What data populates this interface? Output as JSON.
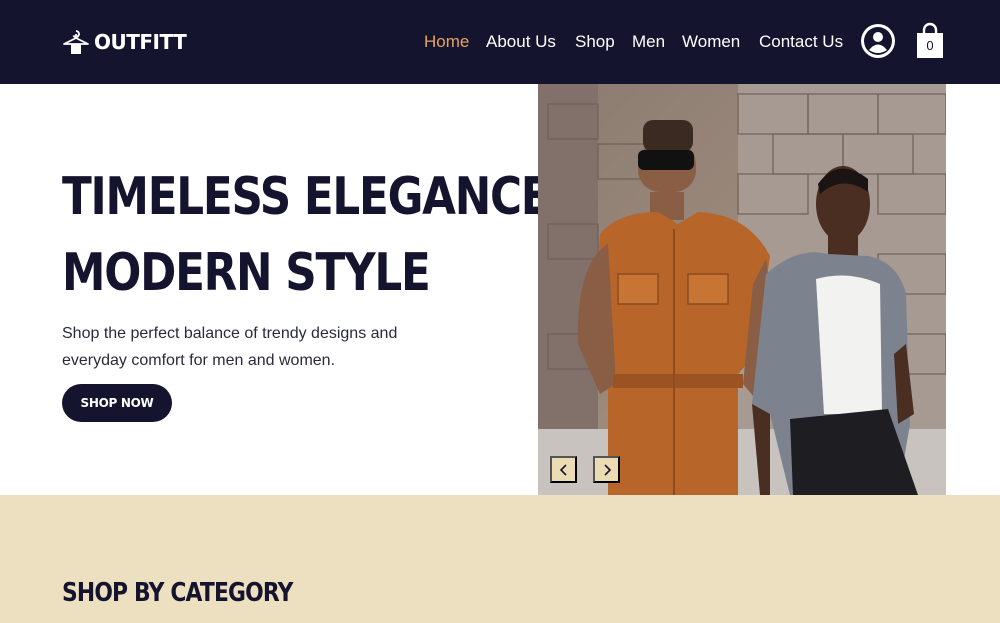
{
  "brand": {
    "name": "OUTFITT",
    "logo_icon": "hanger-icon"
  },
  "nav": {
    "items": [
      {
        "label": "Home",
        "active": true
      },
      {
        "label": "About Us",
        "active": false
      },
      {
        "label": "Shop",
        "active": false
      },
      {
        "label": "Men",
        "active": false
      },
      {
        "label": "Women",
        "active": false
      },
      {
        "label": "Contact Us",
        "active": false
      }
    ],
    "account_icon": "user-avatar-icon",
    "cart_icon": "shopping-bag-icon",
    "cart_count": "0"
  },
  "hero": {
    "title_line1": "TIMELESS ELEGANCE,",
    "title_line2": "MODERN STYLE",
    "subtitle": "Shop the perfect balance of trendy designs and everyday comfort for men and women.",
    "cta_label": "SHOP NOW",
    "prev_icon": "chevron-left-icon",
    "next_icon": "chevron-right-icon"
  },
  "category": {
    "title": "SHOP BY CATEGORY"
  },
  "colors": {
    "navy": "#15142e",
    "accent": "#e4a560",
    "beige": "#ede0c0",
    "arrow_bg": "#ecdcb4"
  }
}
